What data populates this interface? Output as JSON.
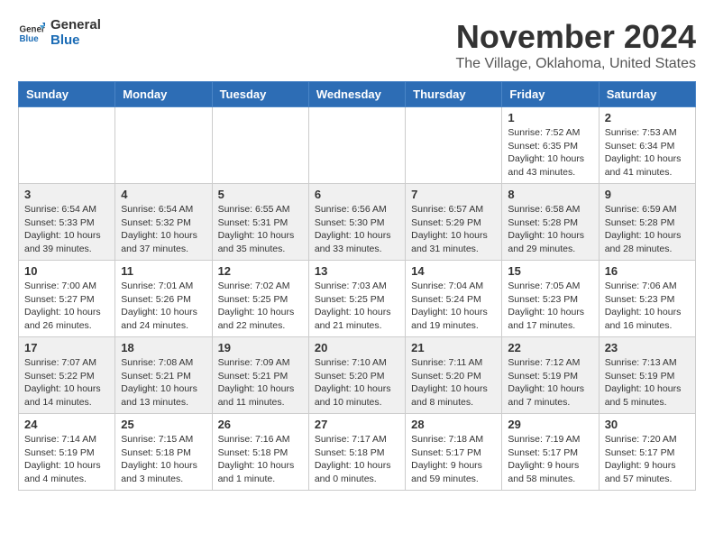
{
  "header": {
    "logo_general": "General",
    "logo_blue": "Blue",
    "month_title": "November 2024",
    "location": "The Village, Oklahoma, United States"
  },
  "days_of_week": [
    "Sunday",
    "Monday",
    "Tuesday",
    "Wednesday",
    "Thursday",
    "Friday",
    "Saturday"
  ],
  "weeks": [
    [
      {
        "day": "",
        "info": ""
      },
      {
        "day": "",
        "info": ""
      },
      {
        "day": "",
        "info": ""
      },
      {
        "day": "",
        "info": ""
      },
      {
        "day": "",
        "info": ""
      },
      {
        "day": "1",
        "info": "Sunrise: 7:52 AM\nSunset: 6:35 PM\nDaylight: 10 hours and 43 minutes."
      },
      {
        "day": "2",
        "info": "Sunrise: 7:53 AM\nSunset: 6:34 PM\nDaylight: 10 hours and 41 minutes."
      }
    ],
    [
      {
        "day": "3",
        "info": "Sunrise: 6:54 AM\nSunset: 5:33 PM\nDaylight: 10 hours and 39 minutes."
      },
      {
        "day": "4",
        "info": "Sunrise: 6:54 AM\nSunset: 5:32 PM\nDaylight: 10 hours and 37 minutes."
      },
      {
        "day": "5",
        "info": "Sunrise: 6:55 AM\nSunset: 5:31 PM\nDaylight: 10 hours and 35 minutes."
      },
      {
        "day": "6",
        "info": "Sunrise: 6:56 AM\nSunset: 5:30 PM\nDaylight: 10 hours and 33 minutes."
      },
      {
        "day": "7",
        "info": "Sunrise: 6:57 AM\nSunset: 5:29 PM\nDaylight: 10 hours and 31 minutes."
      },
      {
        "day": "8",
        "info": "Sunrise: 6:58 AM\nSunset: 5:28 PM\nDaylight: 10 hours and 29 minutes."
      },
      {
        "day": "9",
        "info": "Sunrise: 6:59 AM\nSunset: 5:28 PM\nDaylight: 10 hours and 28 minutes."
      }
    ],
    [
      {
        "day": "10",
        "info": "Sunrise: 7:00 AM\nSunset: 5:27 PM\nDaylight: 10 hours and 26 minutes."
      },
      {
        "day": "11",
        "info": "Sunrise: 7:01 AM\nSunset: 5:26 PM\nDaylight: 10 hours and 24 minutes."
      },
      {
        "day": "12",
        "info": "Sunrise: 7:02 AM\nSunset: 5:25 PM\nDaylight: 10 hours and 22 minutes."
      },
      {
        "day": "13",
        "info": "Sunrise: 7:03 AM\nSunset: 5:25 PM\nDaylight: 10 hours and 21 minutes."
      },
      {
        "day": "14",
        "info": "Sunrise: 7:04 AM\nSunset: 5:24 PM\nDaylight: 10 hours and 19 minutes."
      },
      {
        "day": "15",
        "info": "Sunrise: 7:05 AM\nSunset: 5:23 PM\nDaylight: 10 hours and 17 minutes."
      },
      {
        "day": "16",
        "info": "Sunrise: 7:06 AM\nSunset: 5:23 PM\nDaylight: 10 hours and 16 minutes."
      }
    ],
    [
      {
        "day": "17",
        "info": "Sunrise: 7:07 AM\nSunset: 5:22 PM\nDaylight: 10 hours and 14 minutes."
      },
      {
        "day": "18",
        "info": "Sunrise: 7:08 AM\nSunset: 5:21 PM\nDaylight: 10 hours and 13 minutes."
      },
      {
        "day": "19",
        "info": "Sunrise: 7:09 AM\nSunset: 5:21 PM\nDaylight: 10 hours and 11 minutes."
      },
      {
        "day": "20",
        "info": "Sunrise: 7:10 AM\nSunset: 5:20 PM\nDaylight: 10 hours and 10 minutes."
      },
      {
        "day": "21",
        "info": "Sunrise: 7:11 AM\nSunset: 5:20 PM\nDaylight: 10 hours and 8 minutes."
      },
      {
        "day": "22",
        "info": "Sunrise: 7:12 AM\nSunset: 5:19 PM\nDaylight: 10 hours and 7 minutes."
      },
      {
        "day": "23",
        "info": "Sunrise: 7:13 AM\nSunset: 5:19 PM\nDaylight: 10 hours and 5 minutes."
      }
    ],
    [
      {
        "day": "24",
        "info": "Sunrise: 7:14 AM\nSunset: 5:19 PM\nDaylight: 10 hours and 4 minutes."
      },
      {
        "day": "25",
        "info": "Sunrise: 7:15 AM\nSunset: 5:18 PM\nDaylight: 10 hours and 3 minutes."
      },
      {
        "day": "26",
        "info": "Sunrise: 7:16 AM\nSunset: 5:18 PM\nDaylight: 10 hours and 1 minute."
      },
      {
        "day": "27",
        "info": "Sunrise: 7:17 AM\nSunset: 5:18 PM\nDaylight: 10 hours and 0 minutes."
      },
      {
        "day": "28",
        "info": "Sunrise: 7:18 AM\nSunset: 5:17 PM\nDaylight: 9 hours and 59 minutes."
      },
      {
        "day": "29",
        "info": "Sunrise: 7:19 AM\nSunset: 5:17 PM\nDaylight: 9 hours and 58 minutes."
      },
      {
        "day": "30",
        "info": "Sunrise: 7:20 AM\nSunset: 5:17 PM\nDaylight: 9 hours and 57 minutes."
      }
    ]
  ]
}
